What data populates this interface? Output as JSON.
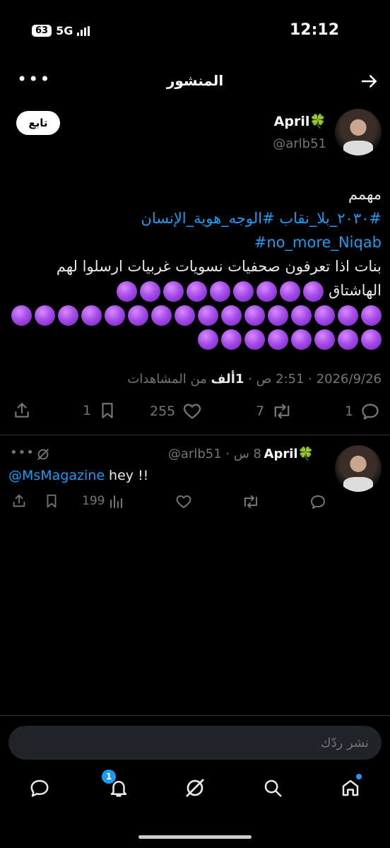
{
  "status": {
    "time": "12:12",
    "battery": "63",
    "network": "5G"
  },
  "header": {
    "title": "المنشور"
  },
  "tweet": {
    "name": "April🍀",
    "handle": "@arlb51",
    "follow_label": "تابع",
    "line1": "مهمم",
    "hashtags_ar": "#٢٠٣٠_بلا_نقاب #الوجه_هوية_الإنسان",
    "hashtag_en": "#no_more_Niqab",
    "line4": "بنات اذا تعرفون صحفيات نسويات غربيات ارسلوا لهم الهاشتاق",
    "emoji_rows": [
      9,
      16,
      8
    ],
    "date": "2026/9/26",
    "time": "2:51 ص",
    "views_count": "1ألف",
    "views_label": "من المشاهدات",
    "replies": "1",
    "retweets": "7",
    "likes": "255",
    "bookmarks": "1"
  },
  "reply": {
    "name": "April🍀",
    "handle": "@arlb51",
    "time": "8 س",
    "mention": "@MsMagazine",
    "text": " hey !!",
    "views": "199"
  },
  "compose": {
    "placeholder": "نشر ردّك"
  },
  "nav": {
    "notif_badge": "1"
  },
  "colors": {
    "accent": "#1d9bf0",
    "muted": "#71767b",
    "emoji": "#a64ce8"
  }
}
